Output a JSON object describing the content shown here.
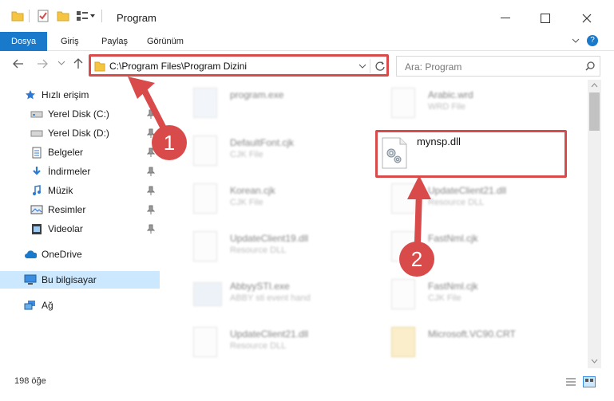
{
  "window": {
    "title": "Program"
  },
  "ribbon": {
    "tabs": [
      "Dosya",
      "Giriş",
      "Paylaş",
      "Görünüm"
    ]
  },
  "address": {
    "path": "C:\\Program Files\\Program Dizini"
  },
  "search": {
    "placeholder": "Ara: Program"
  },
  "sidebar": {
    "items": [
      {
        "label": "Hızlı erişim",
        "icon": "star-icon"
      },
      {
        "label": "Yerel Disk (C:)",
        "icon": "drive-icon"
      },
      {
        "label": "Yerel Disk (D:)",
        "icon": "drive-icon"
      },
      {
        "label": "Belgeler",
        "icon": "documents-icon"
      },
      {
        "label": "İndirmeler",
        "icon": "download-icon"
      },
      {
        "label": "Müzik",
        "icon": "music-icon"
      },
      {
        "label": "Resimler",
        "icon": "pictures-icon"
      },
      {
        "label": "Videolar",
        "icon": "videos-icon"
      },
      {
        "label": "OneDrive",
        "icon": "cloud-icon"
      },
      {
        "label": "Bu bilgisayar",
        "icon": "computer-icon"
      },
      {
        "label": "Ağ",
        "icon": "network-icon"
      }
    ]
  },
  "files": [
    {
      "name": "program.exe",
      "sub": ""
    },
    {
      "name": "Arabic.wrd",
      "sub": "WRD File"
    },
    {
      "name": "DefaultFont.cjk",
      "sub": "CJK File"
    },
    {
      "name": "Korean.cjk",
      "sub": "CJK File"
    },
    {
      "name": "UpdateClient21.dll",
      "sub": "Resource DLL"
    },
    {
      "name": "UpdateClient19.dll",
      "sub": "Resource DLL"
    },
    {
      "name": "FastNml.cjk",
      "sub": ""
    },
    {
      "name": "AbbyySTI.exe",
      "sub": "ABBY sti event hand"
    },
    {
      "name": "FastNml.cjk",
      "sub": "CJK File"
    },
    {
      "name": "UpdateClient21.dll",
      "sub": "Resource DLL"
    },
    {
      "name": "Microsoft.VC90.CRT",
      "sub": ""
    }
  ],
  "highlighted_file": {
    "name": "mynsp.dll"
  },
  "badges": [
    "1",
    "2"
  ],
  "status": {
    "count": "198 öğe"
  },
  "colors": {
    "accent": "#1979ca",
    "highlight": "#d94a4a",
    "selected": "#cce8ff"
  }
}
